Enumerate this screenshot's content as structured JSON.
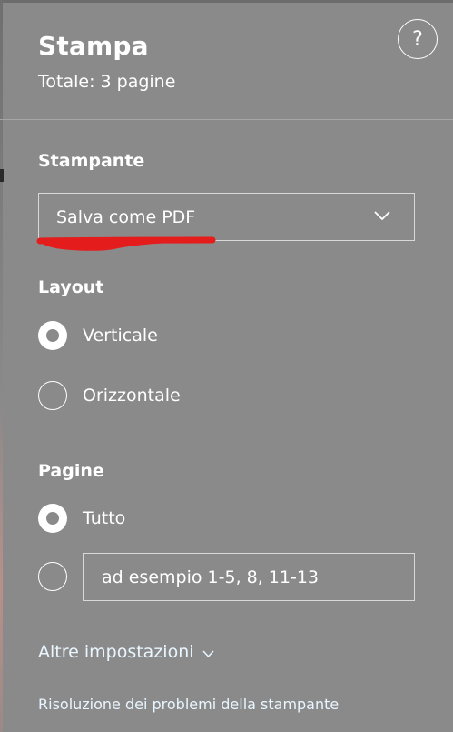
{
  "panel": {
    "title": "Stampa",
    "subtitle": "Totale: 3 pagine",
    "help_label": "?"
  },
  "printer": {
    "label": "Stampante",
    "selected": "Salva come PDF",
    "annotation_color": "#e41c1c"
  },
  "layout": {
    "label": "Layout",
    "options": [
      {
        "label": "Verticale",
        "checked": true
      },
      {
        "label": "Orizzontale",
        "checked": false
      }
    ]
  },
  "pages": {
    "label": "Pagine",
    "options": [
      {
        "label": "Tutto",
        "checked": true
      }
    ],
    "custom_range_placeholder": "ad esempio 1-5, 8, 11-13"
  },
  "links": {
    "more_settings": "Altre impostazioni",
    "troubleshoot": "Risoluzione dei problemi della stampante"
  },
  "icons": {
    "help": "help-icon",
    "dropdown": "chevron-down-icon"
  },
  "colors": {
    "panel_bg": "#8a8a8a",
    "text": "#ffffff",
    "link": "#e9f6ff"
  }
}
